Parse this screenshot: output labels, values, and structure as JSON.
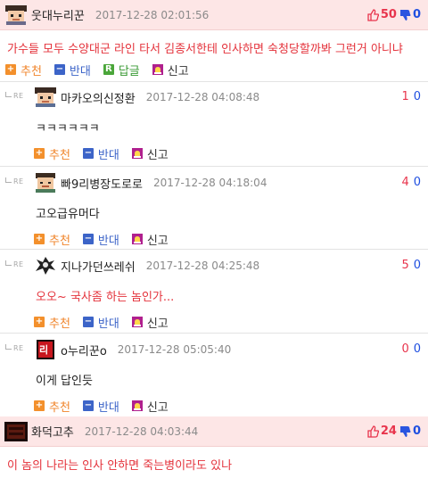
{
  "post": {
    "author": "웃대누리꾼",
    "date": "2017-12-28 02:01:56",
    "up": "50",
    "down": "0",
    "body": "가수들 모두 수양대군 라인 타서 김종서한테 인사하면 숙청당할까봐 그런거 아니냐",
    "actions": {
      "recommend": "추천",
      "oppose": "반대",
      "reply": "답글",
      "report": "신고",
      "reply_badge": "R"
    }
  },
  "reply_mark": "RE",
  "reply_actions": {
    "recommend": "추천",
    "oppose": "반대",
    "report": "신고"
  },
  "replies": [
    {
      "author": "마카오의신정환",
      "date": "2017-12-28 04:08:48",
      "up": "1",
      "down": "0",
      "body": "ㅋㅋㅋㅋㅋㅋ"
    },
    {
      "author": "빠9리병장도로로",
      "date": "2017-12-28 04:18:04",
      "up": "4",
      "down": "0",
      "body": "고오급유머다"
    },
    {
      "author": "지나가던쓰레쉬",
      "date": "2017-12-28 04:25:48",
      "up": "5",
      "down": "0",
      "body": "오오~ 국사좀 하는 놈인가..."
    },
    {
      "author": "o누리꾼o",
      "date": "2017-12-28 05:05:40",
      "up": "0",
      "down": "0",
      "body": "이게 답인듯",
      "avatar_text": "리"
    }
  ],
  "post2": {
    "author": "화덕고추",
    "date": "2017-12-28 04:03:44",
    "up": "24",
    "down": "0",
    "body": "이 놈의 나라는 인사 안하면 죽는병이라도 있나"
  },
  "colors": {
    "header_bg": "#fde6e6",
    "red_text": "#e4323b",
    "up": "#e8344c",
    "down": "#1f4fe0"
  }
}
